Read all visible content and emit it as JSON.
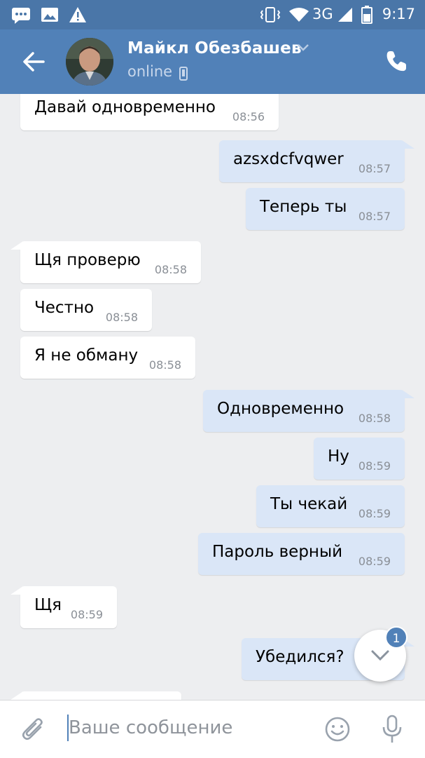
{
  "status_bar": {
    "time": "9:17",
    "network": "3G",
    "icons": [
      "chat-notification-icon",
      "image-notification-icon",
      "warning-icon",
      "vibrate-icon",
      "wifi-icon",
      "signal-icon",
      "battery-icon"
    ]
  },
  "header": {
    "contact_name": "Майкл Обезбашев",
    "status": "online",
    "icons": [
      "back-arrow-icon",
      "chevron-down-icon",
      "mobile-phone-icon",
      "phone-call-icon"
    ]
  },
  "messages": [
    {
      "dir": "in",
      "text": "Давай одновременно",
      "time": "08:56"
    },
    {
      "dir": "out",
      "text": "azsxdcfvqwer",
      "time": "08:57"
    },
    {
      "dir": "out",
      "text": "Теперь ты",
      "time": "08:57"
    },
    {
      "dir": "in",
      "text": "Щя проверю",
      "time": "08:58"
    },
    {
      "dir": "in",
      "text": "Честно",
      "time": "08:58"
    },
    {
      "dir": "in",
      "text": "Я не обману",
      "time": "08:58"
    },
    {
      "dir": "out",
      "text": "Одновременно",
      "time": "08:58"
    },
    {
      "dir": "out",
      "text": "Ну",
      "time": "08:59"
    },
    {
      "dir": "out",
      "text": "Ты чекай",
      "time": "08:59"
    },
    {
      "dir": "out",
      "text": "Пароль верный",
      "time": "08:59"
    },
    {
      "dir": "in",
      "text": "Щя",
      "time": "08:59"
    },
    {
      "dir": "out",
      "text": "Убедился?",
      "time": ""
    }
  ],
  "scroll_down": {
    "badge": "1"
  },
  "composer": {
    "placeholder": "Ваше сообщение",
    "icons": [
      "attach-icon",
      "emoji-icon",
      "microphone-icon"
    ]
  },
  "colors": {
    "header": "#5181b8",
    "status_bar": "#4a76a8",
    "incoming_bubble": "#ffffff",
    "outgoing_bubble": "#dae6f7",
    "background": "#edeef0"
  }
}
